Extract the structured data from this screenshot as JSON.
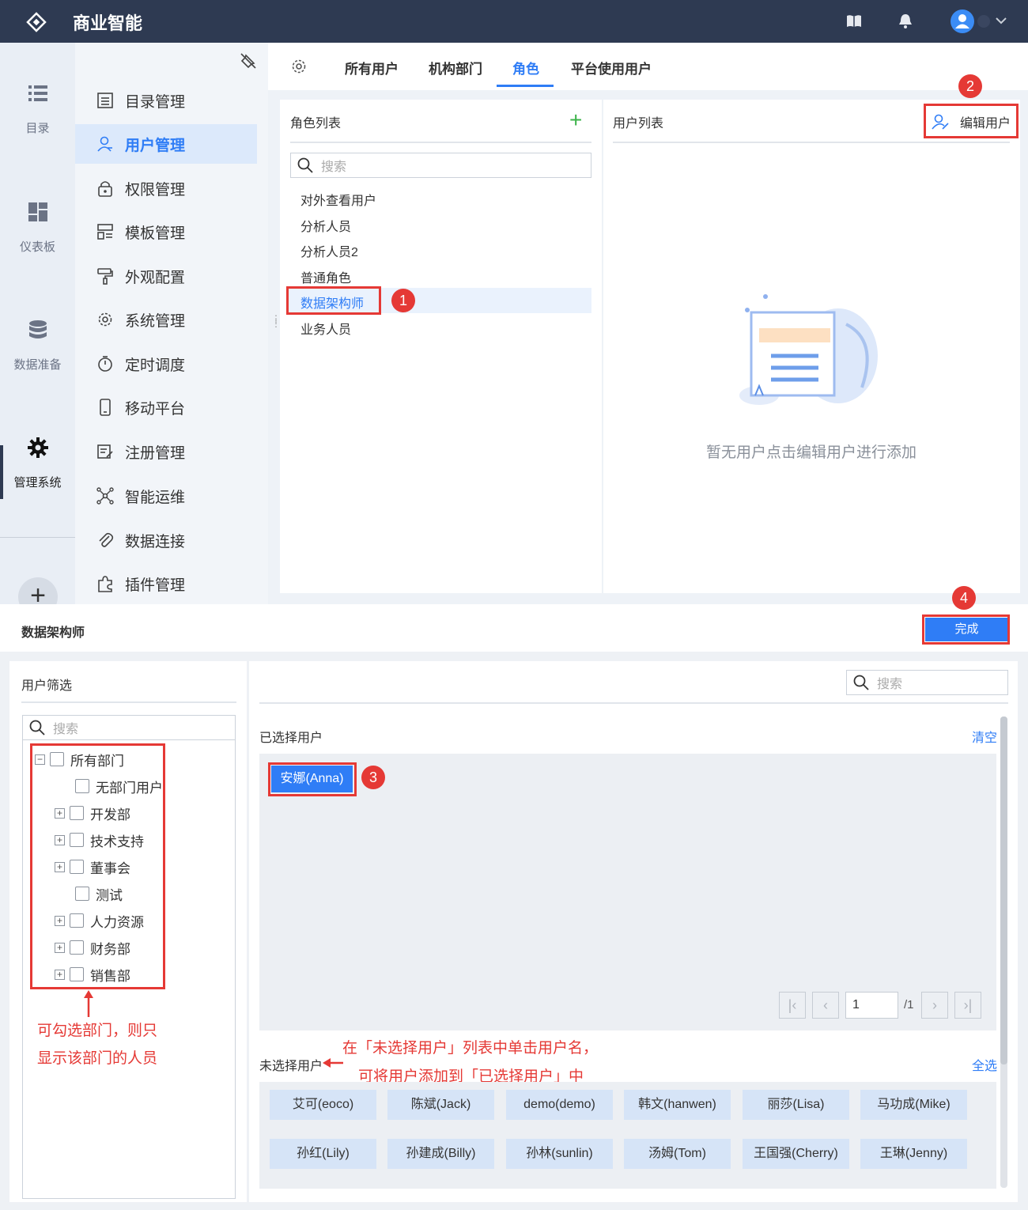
{
  "app": {
    "title": "商业智能"
  },
  "rail": {
    "items": [
      {
        "label": "目录",
        "icon": "list-icon"
      },
      {
        "label": "仪表板",
        "icon": "dashboard-icon"
      },
      {
        "label": "数据准备",
        "icon": "database-icon"
      },
      {
        "label": "管理系统",
        "icon": "gear-icon"
      }
    ],
    "plus": "+"
  },
  "menu": {
    "items": [
      {
        "label": "目录管理"
      },
      {
        "label": "用户管理"
      },
      {
        "label": "权限管理"
      },
      {
        "label": "模板管理"
      },
      {
        "label": "外观配置"
      },
      {
        "label": "系统管理"
      },
      {
        "label": "定时调度"
      },
      {
        "label": "移动平台"
      },
      {
        "label": "注册管理"
      },
      {
        "label": "智能运维"
      },
      {
        "label": "数据连接"
      },
      {
        "label": "插件管理"
      }
    ]
  },
  "tabs": [
    {
      "label": "所有用户"
    },
    {
      "label": "机构部门"
    },
    {
      "label": "角色"
    },
    {
      "label": "平台使用用户"
    }
  ],
  "roles": {
    "title": "角色列表",
    "add": "+",
    "search_placeholder": "搜索",
    "items": [
      "对外查看用户",
      "分析人员",
      "分析人员2",
      "普通角色",
      "数据架构师",
      "业务人员"
    ]
  },
  "users": {
    "title": "用户列表",
    "edit_button": "编辑用户",
    "empty_text": "暂无用户点击编辑用户进行添加"
  },
  "badges": {
    "b1": "1",
    "b2": "2",
    "b3": "3",
    "b4": "4"
  },
  "dialog": {
    "title": "数据架构师",
    "done_button": "完成",
    "filter": {
      "title": "用户筛选",
      "search_placeholder": "搜索",
      "tree": [
        "所有部门",
        "无部门用户",
        "开发部",
        "技术支持",
        "董事会",
        "测试",
        "人力资源",
        "财务部",
        "销售部"
      ]
    },
    "search_placeholder": "搜索",
    "selected": {
      "title": "已选择用户",
      "clear": "清空",
      "users": [
        "安娜(Anna)"
      ]
    },
    "pagination": {
      "page": "1",
      "total": "/1"
    },
    "unselected": {
      "title": "未选择用户",
      "select_all": "全选",
      "users": [
        "艾可(eoco)",
        "陈斌(Jack)",
        "demo(demo)",
        "韩文(hanwen)",
        "丽莎(Lisa)",
        "马功成(Mike)",
        "孙红(Lily)",
        "孙建成(Billy)",
        "孙林(sunlin)",
        "汤姆(Tom)",
        "王国强(Cherry)",
        "王琳(Jenny)"
      ]
    }
  },
  "annotations": {
    "dept_note_1": "可勾选部门，则只",
    "dept_note_2": "显示该部门的人员",
    "click_note_1": "在「未选择用户」列表中单击用户名，",
    "click_note_2": "可将用户添加到「已选择用户」中"
  },
  "colors": {
    "accent": "#2f7df6",
    "topbar": "#2e3a52",
    "annotation": "#e53935"
  }
}
